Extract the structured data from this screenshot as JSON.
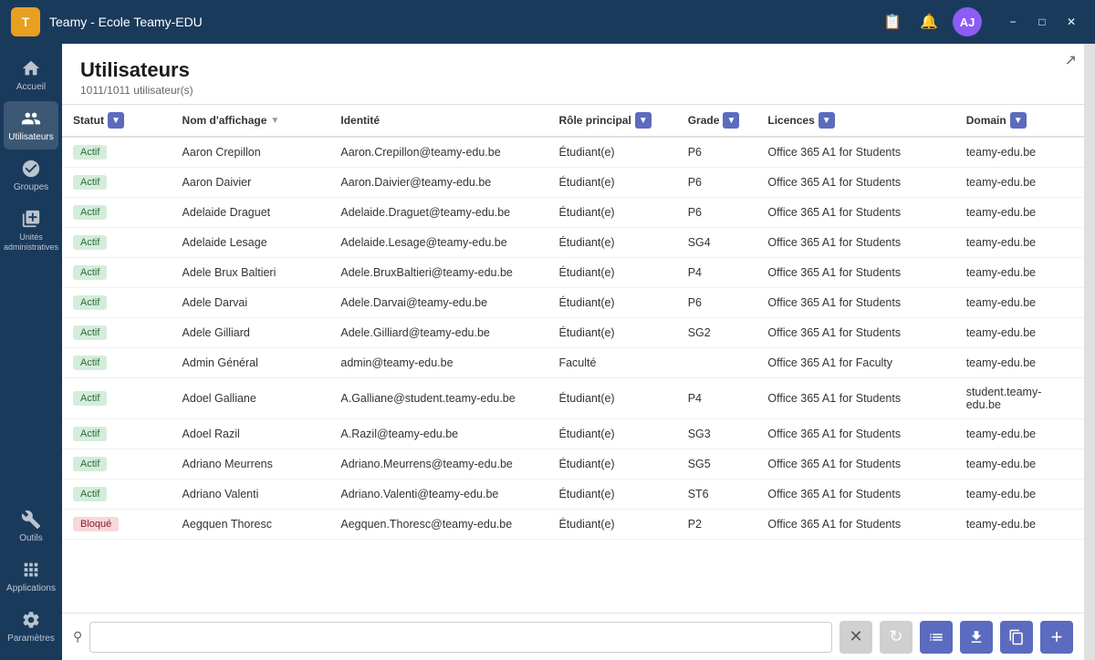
{
  "titlebar": {
    "logo": "T",
    "title": "Teamy - Ecole Teamy-EDU",
    "avatar_initials": "AJ"
  },
  "sidebar": {
    "items": [
      {
        "label": "Accueil",
        "icon": "home"
      },
      {
        "label": "Utilisateurs",
        "icon": "users",
        "active": true
      },
      {
        "label": "Groupes",
        "icon": "groups"
      },
      {
        "label": "Unités administratives",
        "icon": "units"
      },
      {
        "label": "Outils",
        "icon": "tools"
      },
      {
        "label": "Applications",
        "icon": "apps"
      },
      {
        "label": "Paramètres",
        "icon": "settings"
      }
    ]
  },
  "page": {
    "title": "Utilisateurs",
    "subtitle": "1011/1011 utilisateur(s)"
  },
  "table": {
    "columns": [
      {
        "label": "Statut",
        "filterable": true
      },
      {
        "label": "Nom d'affichage",
        "sortable": true
      },
      {
        "label": "Identité"
      },
      {
        "label": "Rôle principal",
        "filterable": true
      },
      {
        "label": "Grade",
        "filterable": true
      },
      {
        "label": "Licences",
        "filterable": true
      },
      {
        "label": "Domain",
        "filterable": true
      }
    ],
    "rows": [
      {
        "statut": "Actif",
        "statut_type": "actif",
        "nom": "Aaron Crepillon",
        "identite": "Aaron.Crepillon@teamy-edu.be",
        "role": "Étudiant(e)",
        "grade": "P6",
        "licence": "Office 365 A1 for Students",
        "domain": "teamy-edu.be"
      },
      {
        "statut": "Actif",
        "statut_type": "actif",
        "nom": "Aaron Daivier",
        "identite": "Aaron.Daivier@teamy-edu.be",
        "role": "Étudiant(e)",
        "grade": "P6",
        "licence": "Office 365 A1 for Students",
        "domain": "teamy-edu.be"
      },
      {
        "statut": "Actif",
        "statut_type": "actif",
        "nom": "Adelaide Draguet",
        "identite": "Adelaide.Draguet@teamy-edu.be",
        "role": "Étudiant(e)",
        "grade": "P6",
        "licence": "Office 365 A1 for Students",
        "domain": "teamy-edu.be"
      },
      {
        "statut": "Actif",
        "statut_type": "actif",
        "nom": "Adelaide Lesage",
        "identite": "Adelaide.Lesage@teamy-edu.be",
        "role": "Étudiant(e)",
        "grade": "SG4",
        "licence": "Office 365 A1 for Students",
        "domain": "teamy-edu.be"
      },
      {
        "statut": "Actif",
        "statut_type": "actif",
        "nom": "Adele Brux Baltieri",
        "identite": "Adele.BruxBaltieri@teamy-edu.be",
        "role": "Étudiant(e)",
        "grade": "P4",
        "licence": "Office 365 A1 for Students",
        "domain": "teamy-edu.be"
      },
      {
        "statut": "Actif",
        "statut_type": "actif",
        "nom": "Adele Darvai",
        "identite": "Adele.Darvai@teamy-edu.be",
        "role": "Étudiant(e)",
        "grade": "P6",
        "licence": "Office 365 A1 for Students",
        "domain": "teamy-edu.be"
      },
      {
        "statut": "Actif",
        "statut_type": "actif",
        "nom": "Adele Gilliard",
        "identite": "Adele.Gilliard@teamy-edu.be",
        "role": "Étudiant(e)",
        "grade": "SG2",
        "licence": "Office 365 A1 for Students",
        "domain": "teamy-edu.be"
      },
      {
        "statut": "Actif",
        "statut_type": "actif",
        "nom": "Admin Général",
        "identite": "admin@teamy-edu.be",
        "role": "Faculté",
        "grade": "",
        "licence": "Office 365 A1 for Faculty",
        "domain": "teamy-edu.be"
      },
      {
        "statut": "Actif",
        "statut_type": "actif",
        "nom": "Adoel Galliane",
        "identite": "A.Galliane@student.teamy-edu.be",
        "role": "Étudiant(e)",
        "grade": "P4",
        "licence": "Office 365 A1 for Students",
        "domain": "student.teamy-edu.be"
      },
      {
        "statut": "Actif",
        "statut_type": "actif",
        "nom": "Adoel Razil",
        "identite": "A.Razil@teamy-edu.be",
        "role": "Étudiant(e)",
        "grade": "SG3",
        "licence": "Office 365 A1 for Students",
        "domain": "teamy-edu.be"
      },
      {
        "statut": "Actif",
        "statut_type": "actif",
        "nom": "Adriano Meurrens",
        "identite": "Adriano.Meurrens@teamy-edu.be",
        "role": "Étudiant(e)",
        "grade": "SG5",
        "licence": "Office 365 A1 for Students",
        "domain": "teamy-edu.be"
      },
      {
        "statut": "Actif",
        "statut_type": "actif",
        "nom": "Adriano Valenti",
        "identite": "Adriano.Valenti@teamy-edu.be",
        "role": "Étudiant(e)",
        "grade": "ST6",
        "licence": "Office 365 A1 for Students",
        "domain": "teamy-edu.be"
      },
      {
        "statut": "Bloqué",
        "statut_type": "bloque",
        "nom": "Aegquen Thoresc",
        "identite": "Aegquen.Thoresc@teamy-edu.be",
        "role": "Étudiant(e)",
        "grade": "P2",
        "licence": "Office 365 A1 for Students",
        "domain": "teamy-edu.be"
      }
    ]
  },
  "bottom": {
    "search_placeholder": "🔍",
    "buttons": [
      {
        "icon": "↺",
        "color": "gray",
        "label": "refresh"
      },
      {
        "icon": "≡",
        "color": "purple",
        "label": "list"
      },
      {
        "icon": "↓",
        "color": "purple",
        "label": "download"
      },
      {
        "icon": "⧉",
        "color": "purple",
        "label": "copy"
      },
      {
        "icon": "+",
        "color": "purple",
        "label": "add"
      }
    ]
  }
}
